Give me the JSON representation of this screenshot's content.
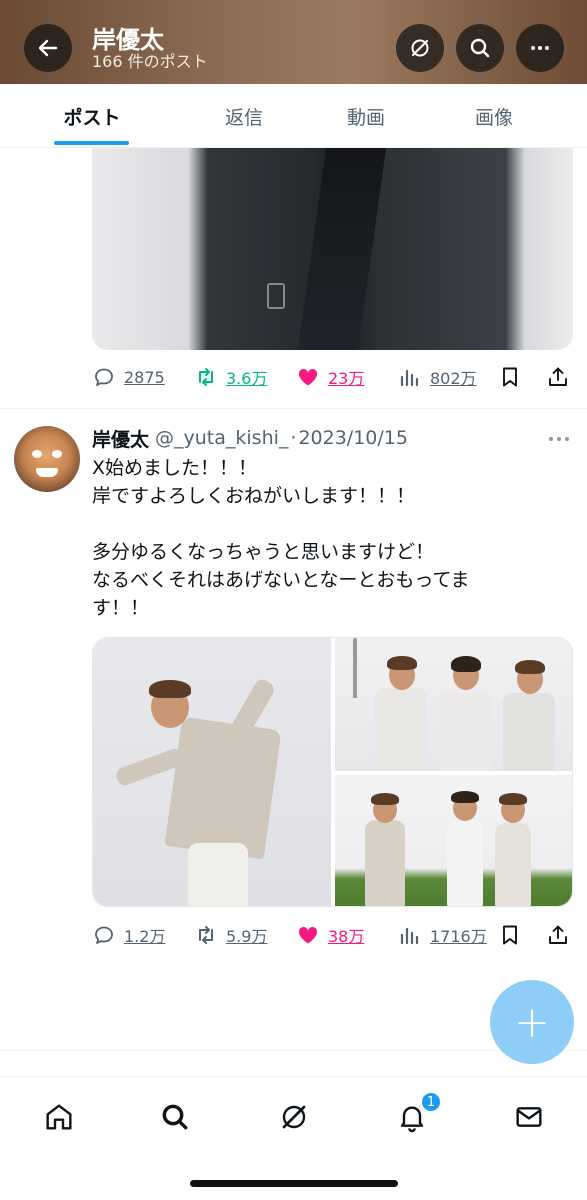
{
  "header": {
    "title": "岸優太",
    "subtitle": "166 件のポスト",
    "back_icon": "arrow-left-icon",
    "grok_icon": "grok-icon",
    "search_icon": "search-icon",
    "more_icon": "more-horizontal-icon"
  },
  "tabs": [
    {
      "label": "ポスト",
      "active": true
    },
    {
      "label": "返信",
      "active": false
    },
    {
      "label": "動画",
      "active": false
    },
    {
      "label": "画像",
      "active": false
    }
  ],
  "post1": {
    "reply_count": "2875",
    "repost_count": "3.6万",
    "like_count": "23万",
    "view_count": "802万",
    "liked": true
  },
  "post2": {
    "author_name": "岸優太",
    "handle": "@_yuta_kishi_",
    "separator": "·",
    "date": "2023/10/15",
    "text_lines": [
      "X始めました！！！",
      "岸ですよろしくおねがいします！！！",
      "",
      "多分ゆるくなっちゃうと思いますけど！",
      "なるべくそれはあげないとなーとおもってま",
      "す！！"
    ],
    "reply_count": "1.2万",
    "repost_count": "5.9万",
    "like_count": "38万",
    "view_count": "1716万",
    "liked": true
  },
  "fab": {
    "label": "+"
  },
  "bottom_nav": {
    "items": [
      "home-icon",
      "search-icon",
      "grok-icon",
      "notifications-icon",
      "messages-icon"
    ],
    "notification_badge": "1"
  },
  "colors": {
    "accent": "#1d9bf0",
    "like": "#f91880",
    "repost": "#00ba7c",
    "secondary_text": "#536471"
  }
}
